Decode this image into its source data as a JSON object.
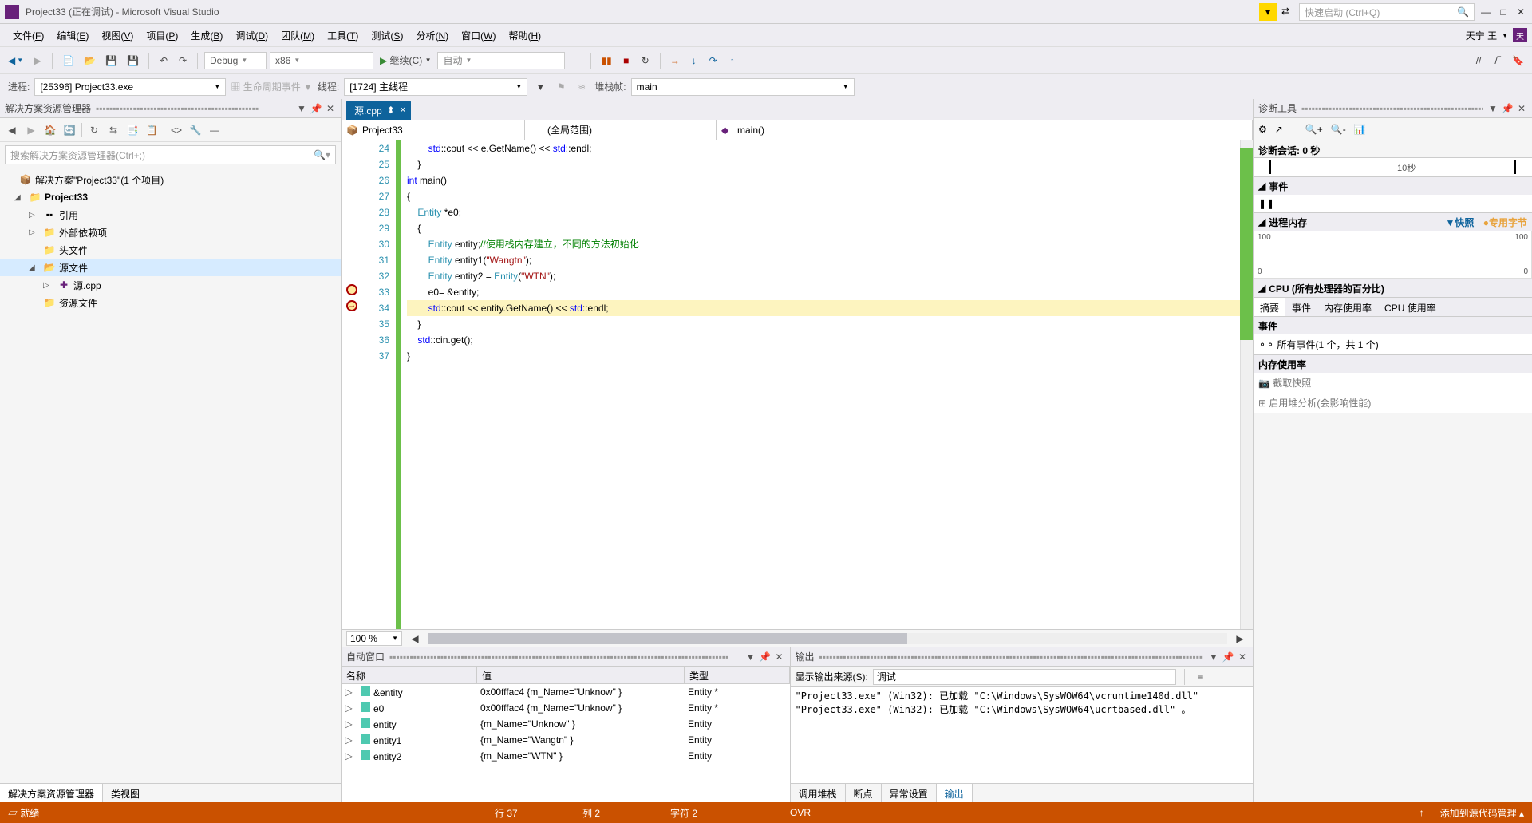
{
  "title": "Project33 (正在调试) - Microsoft Visual Studio",
  "quick_launch_placeholder": "快速启动 (Ctrl+Q)",
  "menubar": [
    {
      "label": "文件",
      "key": "F"
    },
    {
      "label": "编辑",
      "key": "E"
    },
    {
      "label": "视图",
      "key": "V"
    },
    {
      "label": "项目",
      "key": "P"
    },
    {
      "label": "生成",
      "key": "B"
    },
    {
      "label": "调试",
      "key": "D"
    },
    {
      "label": "团队",
      "key": "M"
    },
    {
      "label": "工具",
      "key": "T"
    },
    {
      "label": "测试",
      "key": "S"
    },
    {
      "label": "分析",
      "key": "N"
    },
    {
      "label": "窗口",
      "key": "W"
    },
    {
      "label": "帮助",
      "key": "H"
    }
  ],
  "user_name": "天宁 王",
  "user_initial": "天",
  "toolbar": {
    "config": "Debug",
    "platform": "x86",
    "continue_label": "继续(C)",
    "auto": "自动"
  },
  "debugbar": {
    "process_label": "进程:",
    "process_value": "[25396] Project33.exe",
    "lifecycle_label": "生命周期事件",
    "thread_label": "线程:",
    "thread_value": "[1724] 主线程",
    "stackframe_label": "堆栈帧:",
    "stackframe_value": "main"
  },
  "solution_explorer": {
    "title": "解决方案资源管理器",
    "search_placeholder": "搜索解决方案资源管理器(Ctrl+;)",
    "tree": {
      "solution": "解决方案\"Project33\"(1 个项目)",
      "project": "Project33",
      "refs": "引用",
      "ext_deps": "外部依赖项",
      "headers": "头文件",
      "sources": "源文件",
      "src_cpp": "源.cpp",
      "resources": "资源文件"
    },
    "tabs": {
      "explorer": "解决方案资源管理器",
      "classview": "类视图"
    }
  },
  "doc": {
    "tab_name": "源.cpp",
    "nav": {
      "scope1": "Project33",
      "scope2": "(全局范围)",
      "scope3": "main()"
    },
    "first_line": 24,
    "lines": [
      "        std::cout << e.GetName() << std::endl;",
      "    }",
      "int main()",
      "{",
      "    Entity *e0;",
      "    {",
      "        Entity entity;//使用栈内存建立，不同的方法初始化",
      "        Entity entity1(\"Wangtn\");",
      "        Entity entity2 = Entity(\"WTN\");",
      "        e0= &entity;",
      "        std::cout << entity.GetName() << std::endl;",
      "    }",
      "    std::cin.get();",
      "}"
    ],
    "breakpoint_line": 33,
    "current_line": 34,
    "zoom": "100 %"
  },
  "autos": {
    "title": "自动窗口",
    "cols": {
      "name": "名称",
      "value": "值",
      "type": "类型"
    },
    "rows": [
      {
        "name": "&entity",
        "value": "0x00fffac4 {m_Name=\"Unknow\" }",
        "type": "Entity *"
      },
      {
        "name": "e0",
        "value": "0x00fffac4 {m_Name=\"Unknow\" }",
        "type": "Entity *"
      },
      {
        "name": "entity",
        "value": "{m_Name=\"Unknow\" }",
        "type": "Entity"
      },
      {
        "name": "entity1",
        "value": "{m_Name=\"Wangtn\" }",
        "type": "Entity"
      },
      {
        "name": "entity2",
        "value": "{m_Name=\"WTN\" }",
        "type": "Entity"
      }
    ]
  },
  "output": {
    "title": "输出",
    "source_label": "显示输出来源(S):",
    "source_value": "调试",
    "lines": [
      "\"Project33.exe\" (Win32): 已加载 \"C:\\Windows\\SysWOW64\\vcruntime140d.dll\"",
      "\"Project33.exe\" (Win32): 已加载 \"C:\\Windows\\SysWOW64\\ucrtbased.dll\" 。"
    ],
    "tabs": {
      "callstack": "调用堆栈",
      "breakpoints": "断点",
      "exceptions": "异常设置",
      "output": "输出"
    }
  },
  "diag": {
    "title": "诊断工具",
    "session": "诊断会话: 0 秒",
    "ruler_label": "10秒",
    "events": "事件",
    "mem_title": "进程内存",
    "mem_snap": "快照",
    "mem_priv": "专用字节",
    "mem_hi": "100",
    "mem_lo": "0",
    "cpu_title": "CPU (所有处理器的百分比)",
    "tabs": {
      "summary": "摘要",
      "events": "事件",
      "memory": "内存使用率",
      "cpu": "CPU 使用率"
    },
    "all_events": "所有事件(1 个，共 1 个)",
    "mem_usage": "内存使用率",
    "snap_btn": "截取快照",
    "heap_btn": "启用堆分析(会影响性能)"
  },
  "statusbar": {
    "ready": "就绪",
    "line": "行 37",
    "col": "列 2",
    "char": "字符 2",
    "ovr": "OVR",
    "scm": "添加到源代码管理"
  }
}
